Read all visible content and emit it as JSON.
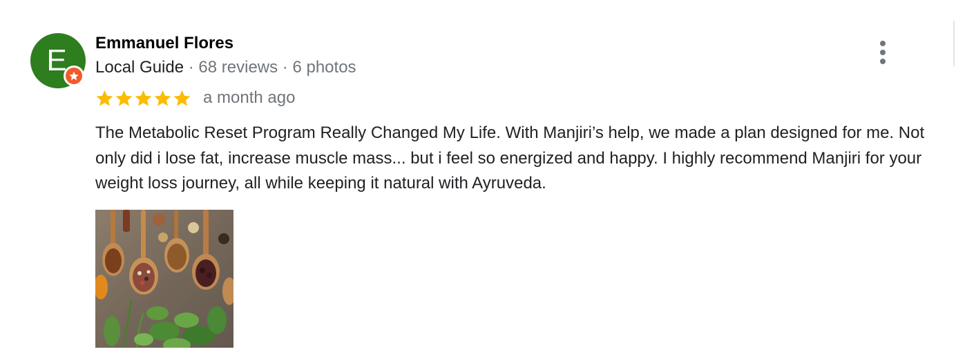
{
  "author": {
    "initial": "E",
    "name": "Emmanuel Flores",
    "guide_label": "Local Guide",
    "separator": " · ",
    "reviews": "68 reviews",
    "photos": "6 photos",
    "avatar_color": "#2e7d1e",
    "badge_color": "#f15a2b",
    "badge_icon": "star-icon"
  },
  "review": {
    "rating": 5,
    "max_rating": 5,
    "star_color": "#fbbc04",
    "time": "a month ago",
    "text": "The Metabolic Reset Program Really Changed My Life. With Manjiri’s help, we made a plan designed for me. Not only did i lose fat, increase muscle mass... but i feel so energized and happy. I highly recommend Manjiri for your weight loss journey, all while keeping it natural with Ayruveda."
  },
  "photo": {
    "subject": "spices-in-wooden-spoons"
  },
  "actions": {
    "more_icon": "more-vert-icon"
  }
}
